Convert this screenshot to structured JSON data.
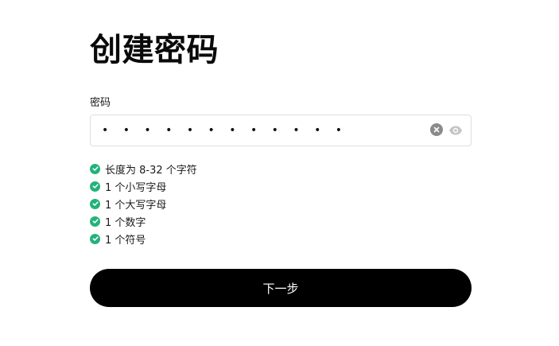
{
  "page": {
    "title": "创建密码"
  },
  "password_field": {
    "label": "密码",
    "value": "• • • • • • • • • • • •",
    "clear_icon": "clear-circle-icon",
    "visibility_icon": "eye-icon"
  },
  "requirements": [
    {
      "text": "长度为 8-32 个字符",
      "met": true
    },
    {
      "text": "1 个小写字母",
      "met": true
    },
    {
      "text": "1 个大写字母",
      "met": true
    },
    {
      "text": "1 个数字",
      "met": true
    },
    {
      "text": "1 个符号",
      "met": true
    }
  ],
  "colors": {
    "check": "#25b27a",
    "button_bg": "#000000",
    "button_text": "#ffffff"
  },
  "actions": {
    "next_label": "下一步"
  }
}
